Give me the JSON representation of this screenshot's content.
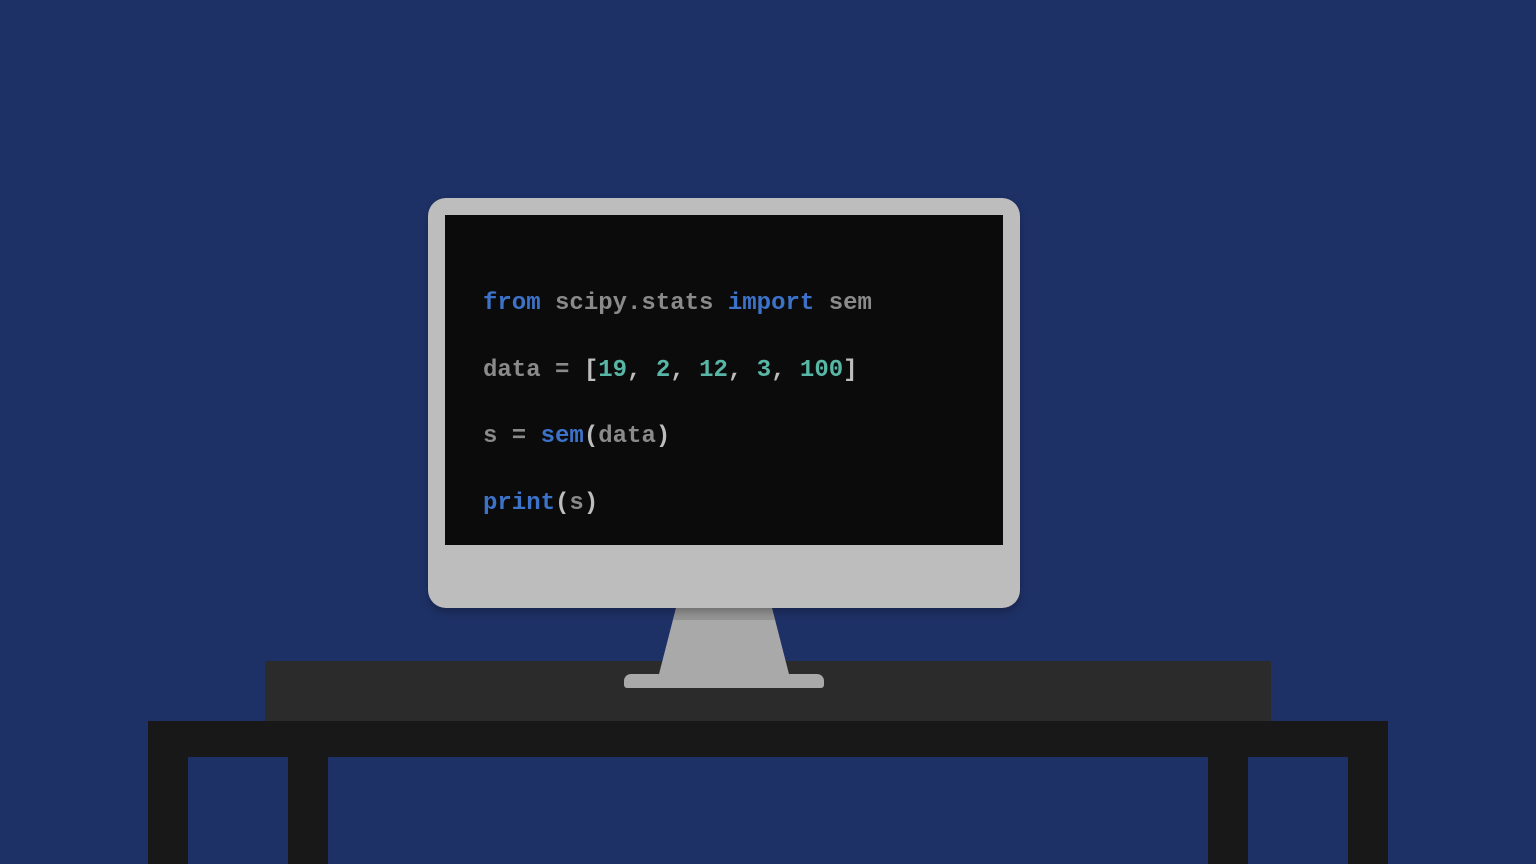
{
  "code": {
    "line1": {
      "kw_from": "from",
      "module": "scipy.stats",
      "kw_import": "import",
      "name": "sem"
    },
    "line2": {
      "var": "data",
      "eq": " = ",
      "lbrack": "[",
      "n1": "19",
      "c1": ", ",
      "n2": "2",
      "c2": ", ",
      "n3": "12",
      "c3": ", ",
      "n4": "3",
      "c4": ", ",
      "n5": "100",
      "rbrack": "]"
    },
    "line3": {
      "var": "s",
      "eq": " = ",
      "fn": "sem",
      "lpar": "(",
      "arg": "data",
      "rpar": ")"
    },
    "line4": {
      "fn": "print",
      "lpar": "(",
      "arg": "s",
      "rpar": ")"
    }
  }
}
